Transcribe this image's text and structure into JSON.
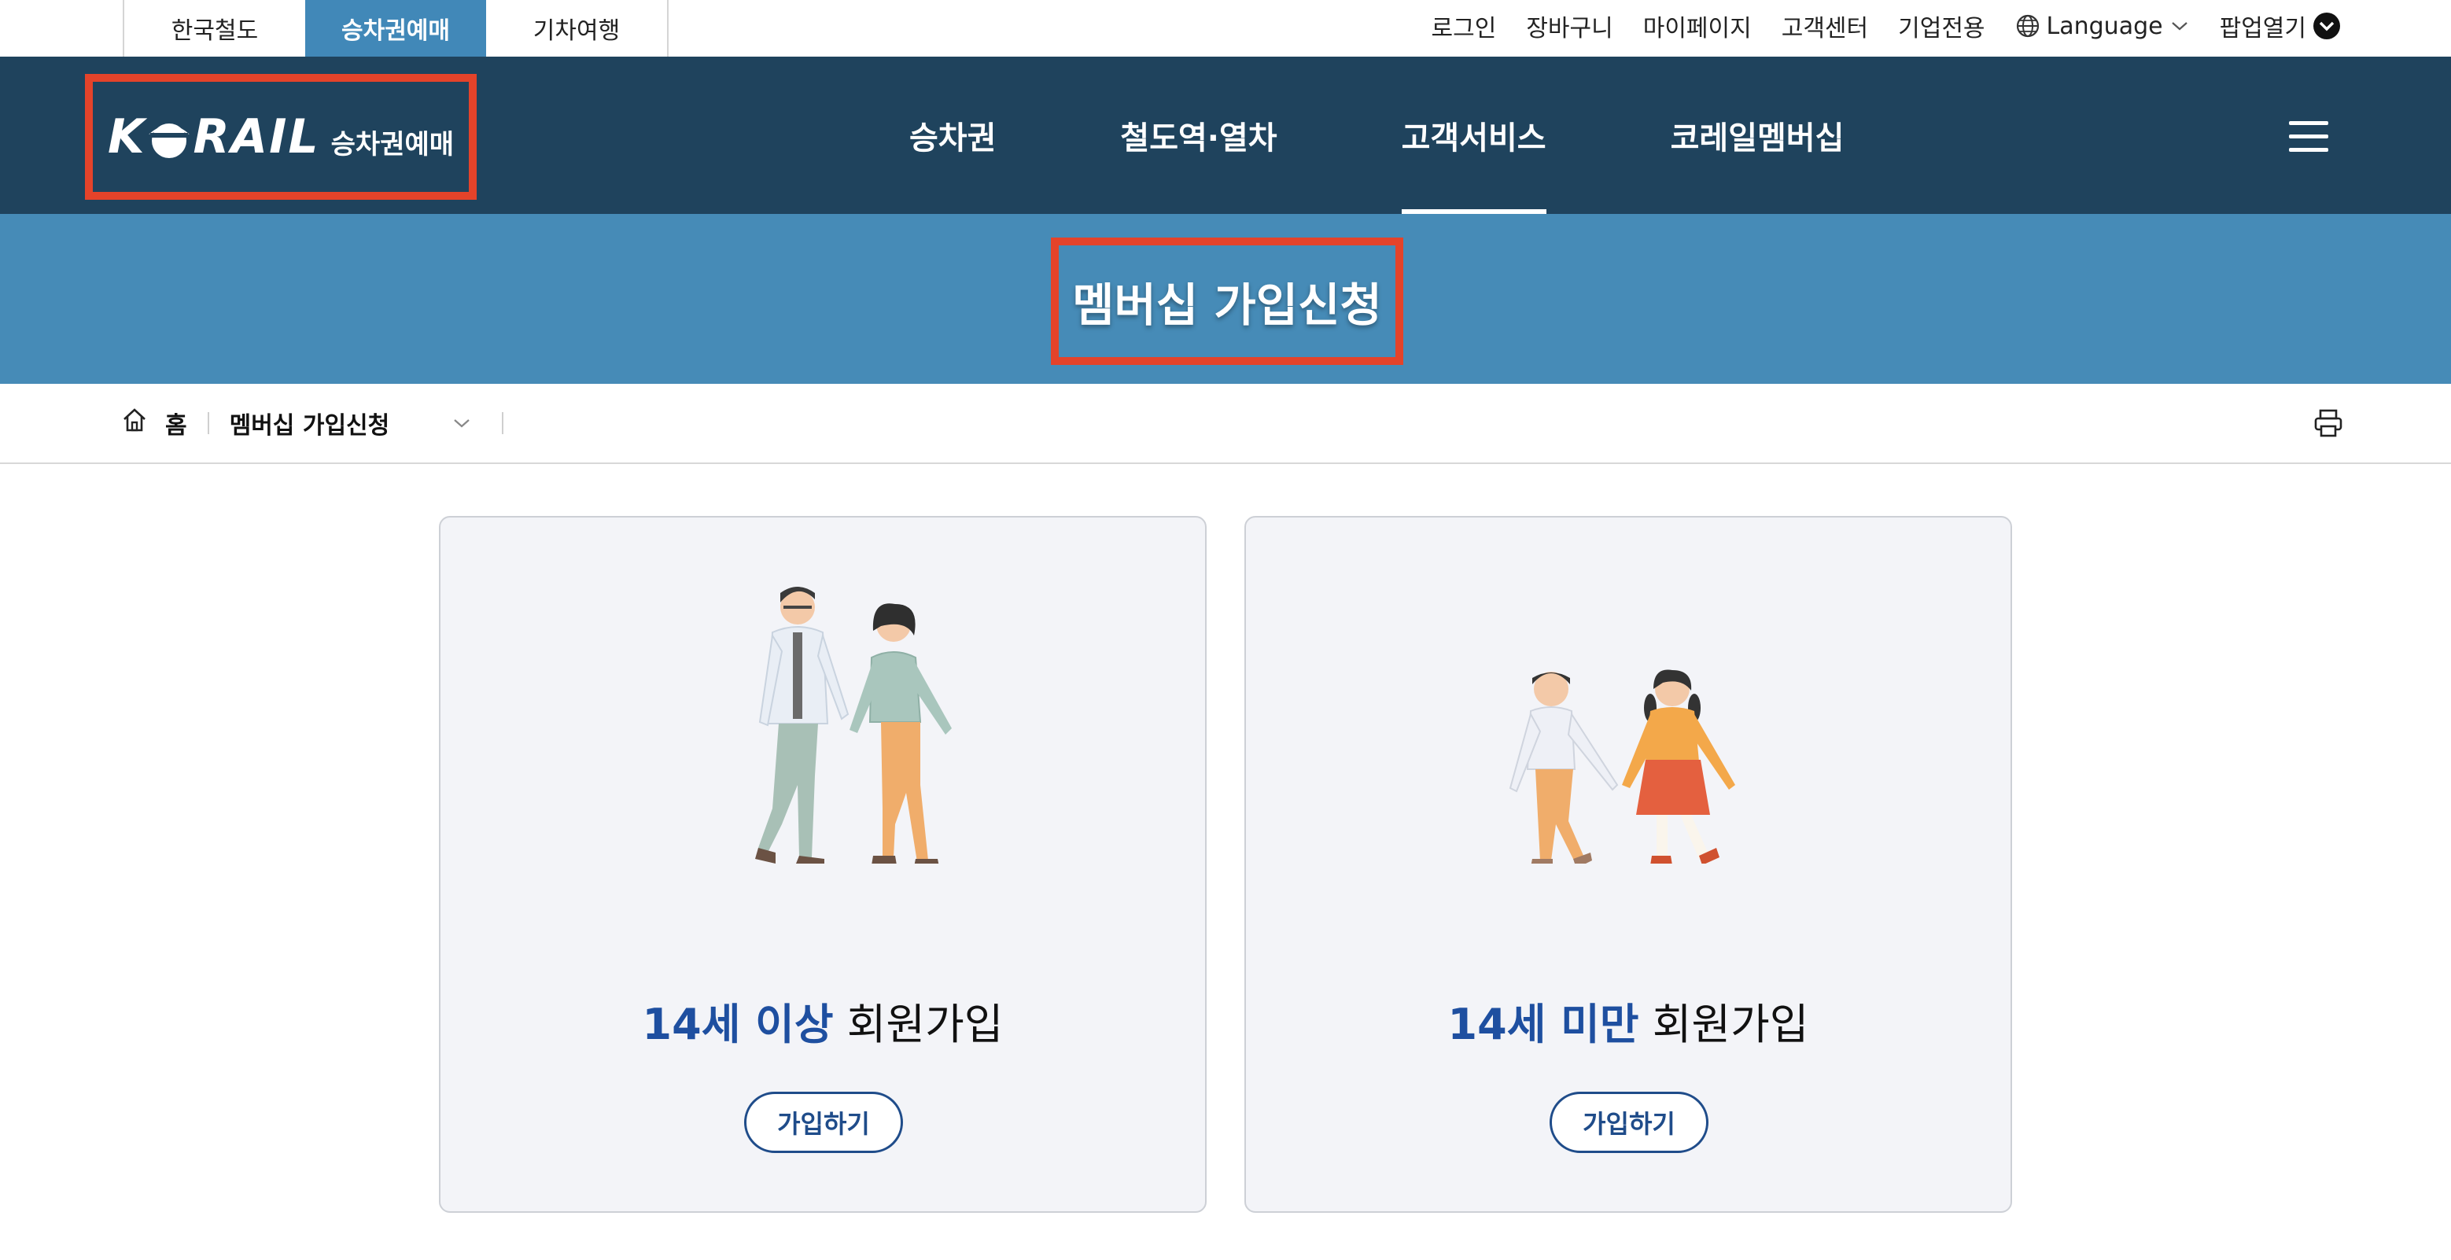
{
  "site_tabs": [
    {
      "label": "한국철도"
    },
    {
      "label": "승차권예매"
    },
    {
      "label": "기차여행"
    }
  ],
  "util_links": {
    "login": "로그인",
    "cart": "장바구니",
    "mypage": "마이페이지",
    "customer_center": "고객센터",
    "corporate": "기업전용",
    "language": "Language",
    "popup": "팝업열기"
  },
  "logo": {
    "left": "K",
    "right": "RAIL",
    "sub": "승차권예매"
  },
  "nav": {
    "items": [
      {
        "label": "승차권"
      },
      {
        "label": "철도역·열차"
      },
      {
        "label": "고객서비스"
      },
      {
        "label": "코레일멤버십"
      }
    ],
    "active_index": 2
  },
  "banner": {
    "title": "멤버십 가입신청"
  },
  "breadcrumb": {
    "home": "홈",
    "current": "멤버십 가입신청"
  },
  "cards": [
    {
      "age": "14세 이상",
      "word": "회원가입",
      "button": "가입하기"
    },
    {
      "age": "14세 미만",
      "word": "회원가입",
      "button": "가입하기"
    }
  ],
  "colors": {
    "nav_bg": "#1f435d",
    "banner_bg": "#468bb7",
    "active_tab": "#4188b8",
    "highlight_border": "#e4432a",
    "accent_blue": "#1e4fa0"
  },
  "icons": [
    "globe-icon",
    "chevron-down-icon",
    "circle-chevron-down-icon",
    "hamburger-icon",
    "home-icon",
    "print-icon"
  ]
}
